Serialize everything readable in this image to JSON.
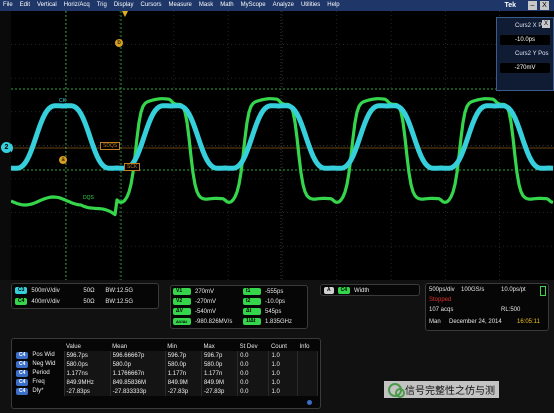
{
  "menu": {
    "items": [
      "File",
      "Edit",
      "Vertical",
      "Horiz/Acq",
      "Trig",
      "Display",
      "Cursors",
      "Measure",
      "Mask",
      "Math",
      "MyScope",
      "Analyze",
      "Utilities",
      "Help"
    ],
    "logo": "Tek",
    "minimize": "–",
    "close": "X"
  },
  "cursor_readout": {
    "x_label": "Curs2 X Pos",
    "x_value": "-10.0ps",
    "y_label": "Curs2 Y Pos",
    "y_value": "-270mV"
  },
  "screen": {
    "marker_a": "a",
    "marker_b": "b",
    "label_ck": "CK",
    "label_dqs": "DQS",
    "ref_box1": "SDQS",
    "ref_box2": "SCK",
    "ch_marker": "2"
  },
  "channels": [
    {
      "badge": "C3",
      "scale": "500mV/div",
      "imp": "50Ω",
      "bw_prefix": "B",
      "bw": "W:12.5G"
    },
    {
      "badge": "C4",
      "scale": "400mV/div",
      "imp": "50Ω",
      "bw_prefix": "B",
      "bw": "W:12.5G"
    }
  ],
  "cursors": {
    "v1_label": "V1",
    "v1": "270mV",
    "v2_label": "V2",
    "v2": "-270mV",
    "dv_label": "ΔV",
    "dv": "-540mV",
    "slope_label": "ΔV/Δt",
    "slope": "-980.826MV/s",
    "t1_label": "t1",
    "t1": "-555ps",
    "t2_label": "t2",
    "t2": "-10.0ps",
    "dt_label": "Δt",
    "dt": "545ps",
    "f_label": "1/Δt",
    "f": "1.835GHz"
  },
  "width_panel": {
    "badge_a": "A",
    "badge_c": "C4",
    "label": "Width"
  },
  "acquisition": {
    "timebase": "500ps/div",
    "rate": "100GS/s",
    "resolution": "10.0ps/pt",
    "state": "Stopped",
    "acqs": "107 acqs",
    "record": "RL:500",
    "mode": "Man",
    "date": "December 24, 2014",
    "time": "16:05:11"
  },
  "measurements": {
    "headers": [
      "",
      "Value",
      "Mean",
      "Min",
      "Max",
      "St Dev",
      "Count",
      "Info"
    ],
    "rows": [
      {
        "badge": "C4",
        "name": "Pos Wid",
        "value": "596.7ps",
        "mean": "596.66667p",
        "min": "596.7p",
        "max": "596.7p",
        "stdev": "0.0",
        "count": "1.0"
      },
      {
        "badge": "C4",
        "name": "Neg Wid",
        "value": "580.0ps",
        "mean": "580.0p",
        "min": "580.0p",
        "max": "580.0p",
        "stdev": "0.0",
        "count": "1.0"
      },
      {
        "badge": "C4",
        "name": "Period",
        "value": "1.177ns",
        "mean": "1.1766667n",
        "min": "1.177n",
        "max": "1.177n",
        "stdev": "0.0",
        "count": "1.0"
      },
      {
        "badge": "C4",
        "name": "Freq",
        "value": "849.9MHz",
        "mean": "849.85836M",
        "min": "849.9M",
        "max": "849.9M",
        "stdev": "0.0",
        "count": "1.0"
      },
      {
        "badge": "C4",
        "name": "Dly*",
        "value": "-27.83ps",
        "mean": "-27.833333p",
        "min": "-27.83p",
        "max": "-27.83p",
        "stdev": "0.0",
        "count": "1.0"
      }
    ]
  },
  "watermark": "信号完整性之仿与测",
  "colors": {
    "cyan": "#36d0dc",
    "green": "#35d64b",
    "menu": "#1e3668",
    "stopped": "#e03030",
    "time": "#f0c020"
  }
}
